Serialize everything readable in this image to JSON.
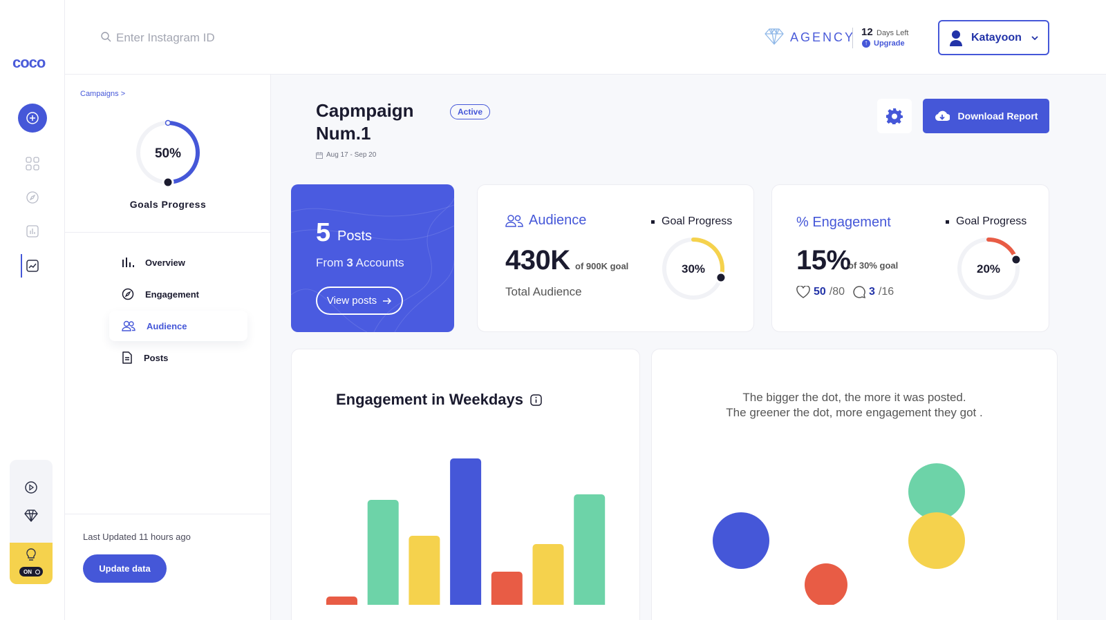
{
  "brand": {
    "logo_text": "coco"
  },
  "search": {
    "placeholder": "Enter Instagram ID"
  },
  "plan": {
    "name": "AGENCY",
    "days_left_num": "12",
    "days_left_text": "Days Left",
    "upgrade_label": "Upgrade"
  },
  "user": {
    "name": "Katayoon"
  },
  "sidebar": {
    "breadcrumb": "Campaigns >",
    "goals_progress": {
      "value": 50,
      "label_pct": "50%",
      "label": "Goals Progress"
    },
    "nav": [
      {
        "label": "Overview",
        "icon": "bar-chart-icon"
      },
      {
        "label": "Engagement",
        "icon": "compass-icon"
      },
      {
        "label": "Audience",
        "icon": "users-icon",
        "active": true
      },
      {
        "label": "Posts",
        "icon": "document-icon"
      }
    ],
    "last_updated": "Last Updated 11 hours ago",
    "update_button": "Update data"
  },
  "campaign": {
    "title": "Capmpaign Num.1",
    "status": "Active",
    "date_range": "Aug 17 - Sep 20",
    "download_label": "Download Report"
  },
  "posts_card": {
    "count": "5",
    "count_word": "Posts",
    "from_prefix": "From",
    "accounts_count": "3",
    "accounts_word": "Accounts",
    "view_label": "View posts"
  },
  "audience_card": {
    "title": "Audience",
    "goal_progress_label": "Goal Progress",
    "value": "430K",
    "goal_text": "of 900K goal",
    "subtitle": "Total Audience",
    "progress": 30,
    "progress_label": "30%"
  },
  "engagement_card": {
    "title": "% Engagement",
    "goal_progress_label": "Goal Progress",
    "value": "15%",
    "goal_text": "of 30% goal",
    "likes": "50",
    "likes_total": "/80",
    "comments": "3",
    "comments_total": "/16",
    "progress": 20,
    "progress_label": "20%"
  },
  "weekday_chart": {
    "title": "Engagement in Weekdays"
  },
  "bubble_chart": {
    "note_line1": "The bigger the dot, the more it was posted.",
    "note_line2": "The greener the dot, more engagement they got ."
  },
  "colors": {
    "accent": "#4557d8",
    "green": "#6dd3a8",
    "yellow": "#f5d24d",
    "red": "#e85c45",
    "ring_yellow": "#f5d24d",
    "ring_red": "#e85c45"
  },
  "chart_data": [
    {
      "type": "bar",
      "values": [
        3,
        38,
        25,
        53,
        12,
        22,
        40
      ],
      "colors": [
        "#e85c45",
        "#6dd3a8",
        "#f5d24d",
        "#4557d8",
        "#e85c45",
        "#f5d24d",
        "#6dd3a8"
      ]
    },
    {
      "type": "scatter",
      "points": [
        {
          "x": 1,
          "y": 2,
          "size": 41,
          "color": "#4557d8"
        },
        {
          "x": 2,
          "y": 1,
          "size": 31,
          "color": "#e85c45"
        },
        {
          "x": 3,
          "y": 3,
          "size": 41,
          "color": "#6dd3a8"
        },
        {
          "x": 3,
          "y": 2,
          "size": 41,
          "color": "#f5d24d"
        }
      ]
    }
  ]
}
